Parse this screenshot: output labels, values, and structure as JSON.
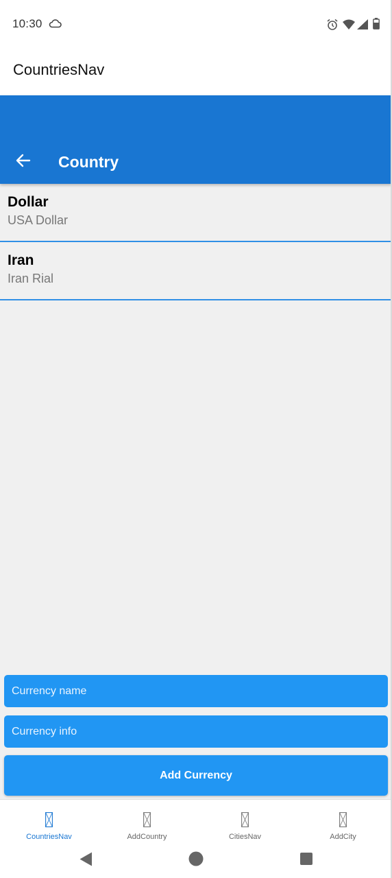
{
  "status_bar": {
    "time": "10:30",
    "icons": [
      "cloud-icon",
      "alarm-icon",
      "wifi-icon",
      "signal-icon",
      "battery-icon"
    ]
  },
  "app_bar": {
    "title": "CountriesNav"
  },
  "nav_header": {
    "title": "Country",
    "back_icon": "arrow-left-icon"
  },
  "currencies": [
    {
      "name": "Dollar",
      "info": "USA Dollar"
    },
    {
      "name": "Iran",
      "info": "Iran Rial"
    }
  ],
  "form": {
    "currency_name_placeholder": "Currency name",
    "currency_info_placeholder": "Currency info",
    "currency_name_value": "",
    "currency_info_value": "",
    "add_button_label": "Add Currency"
  },
  "tabs": [
    {
      "label": "CountriesNav",
      "active": true
    },
    {
      "label": "AddCountry",
      "active": false
    },
    {
      "label": "CitiesNav",
      "active": false
    },
    {
      "label": "AddCity",
      "active": false
    }
  ],
  "colors": {
    "header": "#1976d2",
    "accent": "#2196f3",
    "divider": "#2f8fe6",
    "background": "#f0f0f0",
    "active_tab": "#1976d2",
    "inactive_tab": "#666666"
  }
}
